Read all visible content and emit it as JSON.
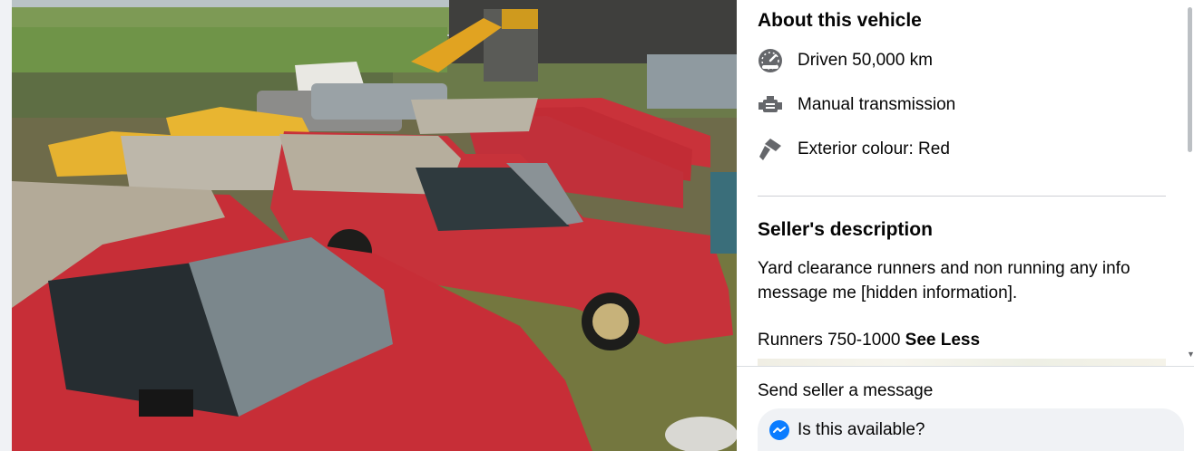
{
  "about": {
    "title": "About this vehicle",
    "items": [
      {
        "icon": "speedometer-icon",
        "label": "Driven 50,000 km"
      },
      {
        "icon": "engine-icon",
        "label": "Manual transmission"
      },
      {
        "icon": "paint-brush-icon",
        "label": "Exterior colour: Red"
      }
    ]
  },
  "seller": {
    "title": "Seller's description",
    "text": "Yard clearance runners and non running any info message me  [hidden information].",
    "text2": "Runners 750-1000",
    "see_less": "See Less"
  },
  "message": {
    "title": "Send seller a message",
    "input_value": "Is this available?"
  },
  "colors": {
    "text": "#050505",
    "messenger_blue": "#0a7cff",
    "icon_gray": "#65676b",
    "input_bg": "#f0f2f5"
  }
}
